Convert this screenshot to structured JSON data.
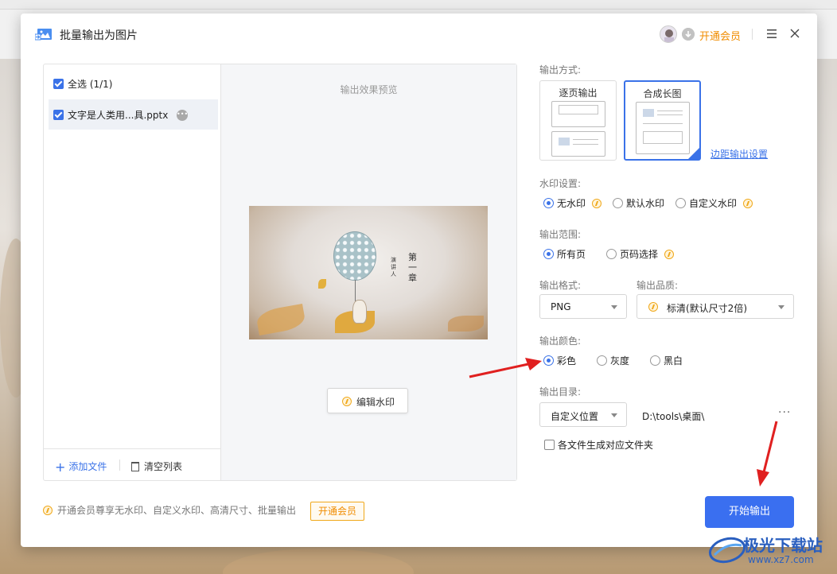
{
  "dialog": {
    "title": "批量输出为图片",
    "vip_label": "开通会员",
    "title_icon": "image-export-icon",
    "menu_icon": "hamburger-menu-icon",
    "close_icon": "close-icon"
  },
  "file_list": {
    "select_all": "全选 (1/1)",
    "files": [
      {
        "name": "文字是人类用...具.pptx",
        "checked": true
      }
    ],
    "add_file": "添加文件",
    "clear_list": "清空列表"
  },
  "preview": {
    "label": "输出效果预览",
    "slide_title": "第一章",
    "slide_subtitle": "演讲人",
    "edit_watermark": "编辑水印"
  },
  "settings": {
    "output_mode_label": "输出方式:",
    "output_modes": [
      {
        "label": "逐页输出",
        "selected": false
      },
      {
        "label": "合成长图",
        "selected": true
      }
    ],
    "margin_settings": "边距输出设置",
    "watermark_label": "水印设置:",
    "watermark_options": [
      {
        "label": "无水印",
        "selected": true,
        "vip": true
      },
      {
        "label": "默认水印",
        "selected": false,
        "vip": false
      },
      {
        "label": "自定义水印",
        "selected": false,
        "vip": true
      }
    ],
    "range_label": "输出范围:",
    "range_options": [
      {
        "label": "所有页",
        "selected": true,
        "vip": false
      },
      {
        "label": "页码选择",
        "selected": false,
        "vip": true
      }
    ],
    "format_label": "输出格式:",
    "format_value": "PNG",
    "quality_label": "输出品质:",
    "quality_value": "标清(默认尺寸2倍)",
    "color_label": "输出颜色:",
    "color_options": [
      {
        "label": "彩色",
        "selected": true
      },
      {
        "label": "灰度",
        "selected": false
      },
      {
        "label": "黑白",
        "selected": false
      }
    ],
    "directory_label": "输出目录:",
    "directory_mode": "自定义位置",
    "directory_path": "D:\\tools\\桌面\\",
    "more_button": "···",
    "per_file_folder": "各文件生成对应文件夹"
  },
  "footer": {
    "promo_text": "开通会员尊享无水印、自定义水印、高清尺寸、批量输出",
    "promo_button": "开通会员",
    "start_button": "开始输出"
  },
  "watermark_logo": {
    "name": "极光下载站",
    "url": "www.xz7.com"
  },
  "colors": {
    "accent": "#3a72e8",
    "vip_orange": "#f08c00",
    "arrow_red": "#e02020"
  }
}
